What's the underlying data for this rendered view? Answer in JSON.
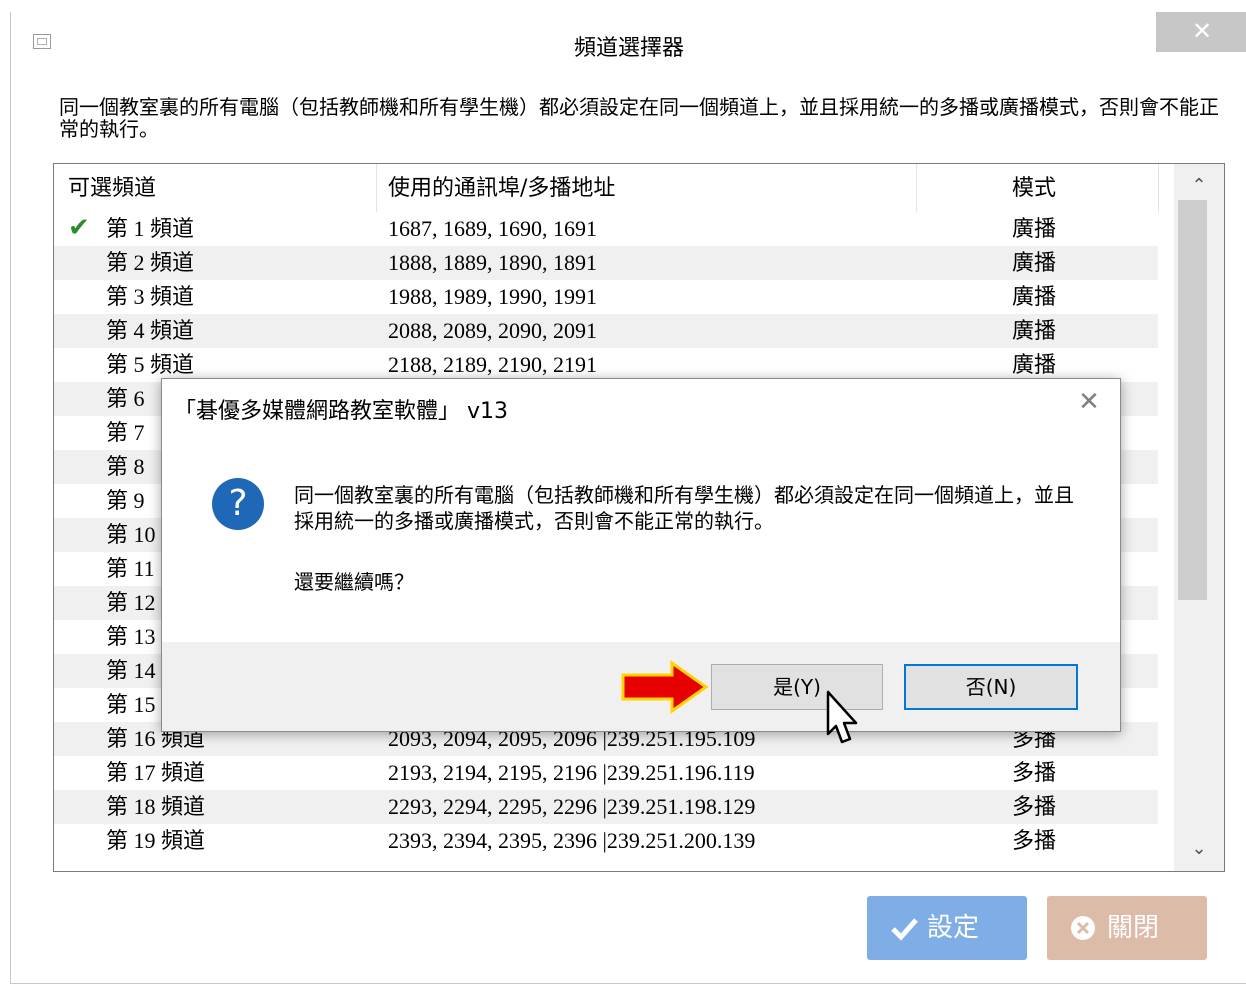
{
  "window": {
    "title": "頻道選擇器",
    "close_glyph": "✕"
  },
  "description": "同一個教室裏的所有電腦（包括教師機和所有學生機）都必須設定在同一個頻道上，並且採用統一的多播或廣播模式，否則會不能正常的執行。",
  "list": {
    "headers": {
      "channel": "可選頻道",
      "ports": "使用的通訊埠/多播地址",
      "mode": "模式"
    },
    "rows": [
      {
        "channel": "第 1 頻道",
        "ports": "1687, 1689, 1690, 1691",
        "mode": "廣播",
        "selected": true
      },
      {
        "channel": "第 2 頻道",
        "ports": "1888, 1889, 1890, 1891",
        "mode": "廣播"
      },
      {
        "channel": "第 3 頻道",
        "ports": "1988, 1989, 1990, 1991",
        "mode": "廣播"
      },
      {
        "channel": "第 4 頻道",
        "ports": "2088, 2089, 2090, 2091",
        "mode": "廣播"
      },
      {
        "channel": "第 5 頻道",
        "ports": "2188, 2189, 2190, 2191",
        "mode": "廣播"
      },
      {
        "channel": "第 6",
        "ports": "",
        "mode": ""
      },
      {
        "channel": "第 7",
        "ports": "",
        "mode": ""
      },
      {
        "channel": "第 8",
        "ports": "",
        "mode": ""
      },
      {
        "channel": "第 9",
        "ports": "",
        "mode": ""
      },
      {
        "channel": "第 10",
        "ports": "",
        "mode": ""
      },
      {
        "channel": "第 11",
        "ports": "",
        "mode": ""
      },
      {
        "channel": "第 12",
        "ports": "",
        "mode": ""
      },
      {
        "channel": "第 13",
        "ports": "",
        "mode": ""
      },
      {
        "channel": "第 14",
        "ports": "",
        "mode": ""
      },
      {
        "channel": "第 15",
        "ports": "",
        "mode": ""
      },
      {
        "channel": "第 16 頻道",
        "ports": "2093, 2094, 2095, 2096 |239.251.195.109",
        "mode": "多播"
      },
      {
        "channel": "第 17 頻道",
        "ports": "2193, 2194, 2195, 2196 |239.251.196.119",
        "mode": "多播"
      },
      {
        "channel": "第 18 頻道",
        "ports": "2293, 2294, 2295, 2296 |239.251.198.129",
        "mode": "多播"
      },
      {
        "channel": "第 19 頻道",
        "ports": "2393, 2394, 2395, 2396 |239.251.200.139",
        "mode": "多播"
      }
    ],
    "scroll_up": "⌃",
    "scroll_down": "⌄"
  },
  "buttons": {
    "ok_label": "設定",
    "close_label": "關閉"
  },
  "dialog": {
    "title": "「碁優多媒體網路教室軟體」 v13",
    "close_glyph": "✕",
    "icon_glyph": "?",
    "message": "同一個教室裏的所有電腦（包括教師機和所有學生機）都必須設定在同一個頻道上，並且採用統一的多播或廣播模式，否則會不能正常的執行。",
    "question": "還要繼續嗎？",
    "yes_label": "是(Y)",
    "no_label": "否(N)"
  },
  "colors": {
    "accent_blue": "#0078d7",
    "ok_button": "#7faee6",
    "close_button": "#dcbba8",
    "annotation_arrow": "#e60000"
  }
}
